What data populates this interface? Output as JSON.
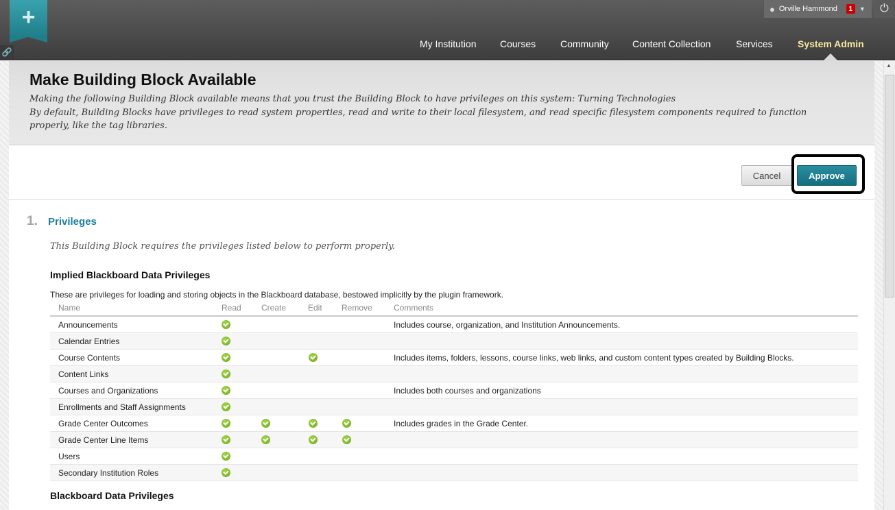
{
  "topbar": {
    "user_name": "Orville Hammond",
    "notification_count": "1",
    "nav": [
      {
        "label": "My Institution",
        "active": false
      },
      {
        "label": "Courses",
        "active": false
      },
      {
        "label": "Community",
        "active": false
      },
      {
        "label": "Content Collection",
        "active": false
      },
      {
        "label": "Services",
        "active": false
      },
      {
        "label": "System Admin",
        "active": true
      }
    ]
  },
  "header": {
    "title": "Make Building Block Available",
    "description_line1": "Making the following Building Block available means that you trust the Building Block to have privileges on this system: Turning Technologies",
    "description_line2": "By default, Building Blocks have privileges to read system properties, read and write to their local filesystem, and read specific filesystem components required to function properly, like the tag libraries."
  },
  "actions": {
    "cancel_label": "Cancel",
    "approve_label": "Approve"
  },
  "section": {
    "number": "1.",
    "title": "Privileges",
    "description": "This Building Block requires the privileges listed below to perform properly."
  },
  "implied": {
    "heading": "Implied Blackboard Data Privileges",
    "description": "These are privileges for loading and storing objects in the Blackboard database, bestowed implicitly by the plugin framework.",
    "columns": [
      "Name",
      "Read",
      "Create",
      "Edit",
      "Remove",
      "Comments"
    ],
    "rows": [
      {
        "name": "Announcements",
        "read": true,
        "create": false,
        "edit": false,
        "remove": false,
        "comments": "Includes course, organization, and Institution Announcements."
      },
      {
        "name": "Calendar Entries",
        "read": true,
        "create": false,
        "edit": false,
        "remove": false,
        "comments": ""
      },
      {
        "name": "Course Contents",
        "read": true,
        "create": false,
        "edit": true,
        "remove": false,
        "comments": "Includes items, folders, lessons, course links, web links, and custom content types created by Building Blocks."
      },
      {
        "name": "Content Links",
        "read": true,
        "create": false,
        "edit": false,
        "remove": false,
        "comments": ""
      },
      {
        "name": "Courses and Organizations",
        "read": true,
        "create": false,
        "edit": false,
        "remove": false,
        "comments": "Includes both courses and organizations"
      },
      {
        "name": "Enrollments and Staff Assignments",
        "read": true,
        "create": false,
        "edit": false,
        "remove": false,
        "comments": ""
      },
      {
        "name": "Grade Center Outcomes",
        "read": true,
        "create": true,
        "edit": true,
        "remove": true,
        "comments": "Includes grades in the Grade Center."
      },
      {
        "name": "Grade Center Line Items",
        "read": true,
        "create": true,
        "edit": true,
        "remove": true,
        "comments": ""
      },
      {
        "name": "Users",
        "read": true,
        "create": false,
        "edit": false,
        "remove": false,
        "comments": ""
      },
      {
        "name": "Secondary Institution Roles",
        "read": true,
        "create": false,
        "edit": false,
        "remove": false,
        "comments": ""
      }
    ]
  },
  "bb_privileges": {
    "heading": "Blackboard Data Privileges"
  },
  "icons": {
    "logo": "plus-icon",
    "link": "link-icon",
    "user": "user-icon",
    "power": "power-icon",
    "check": "check-icon"
  },
  "colors": {
    "topbar": "#4a4a4a",
    "accent": "#1f7e8a",
    "active_nav": "#f9e79c",
    "approve": "#146e80",
    "section_title": "#1d7fa0",
    "check": "#7bb526"
  }
}
